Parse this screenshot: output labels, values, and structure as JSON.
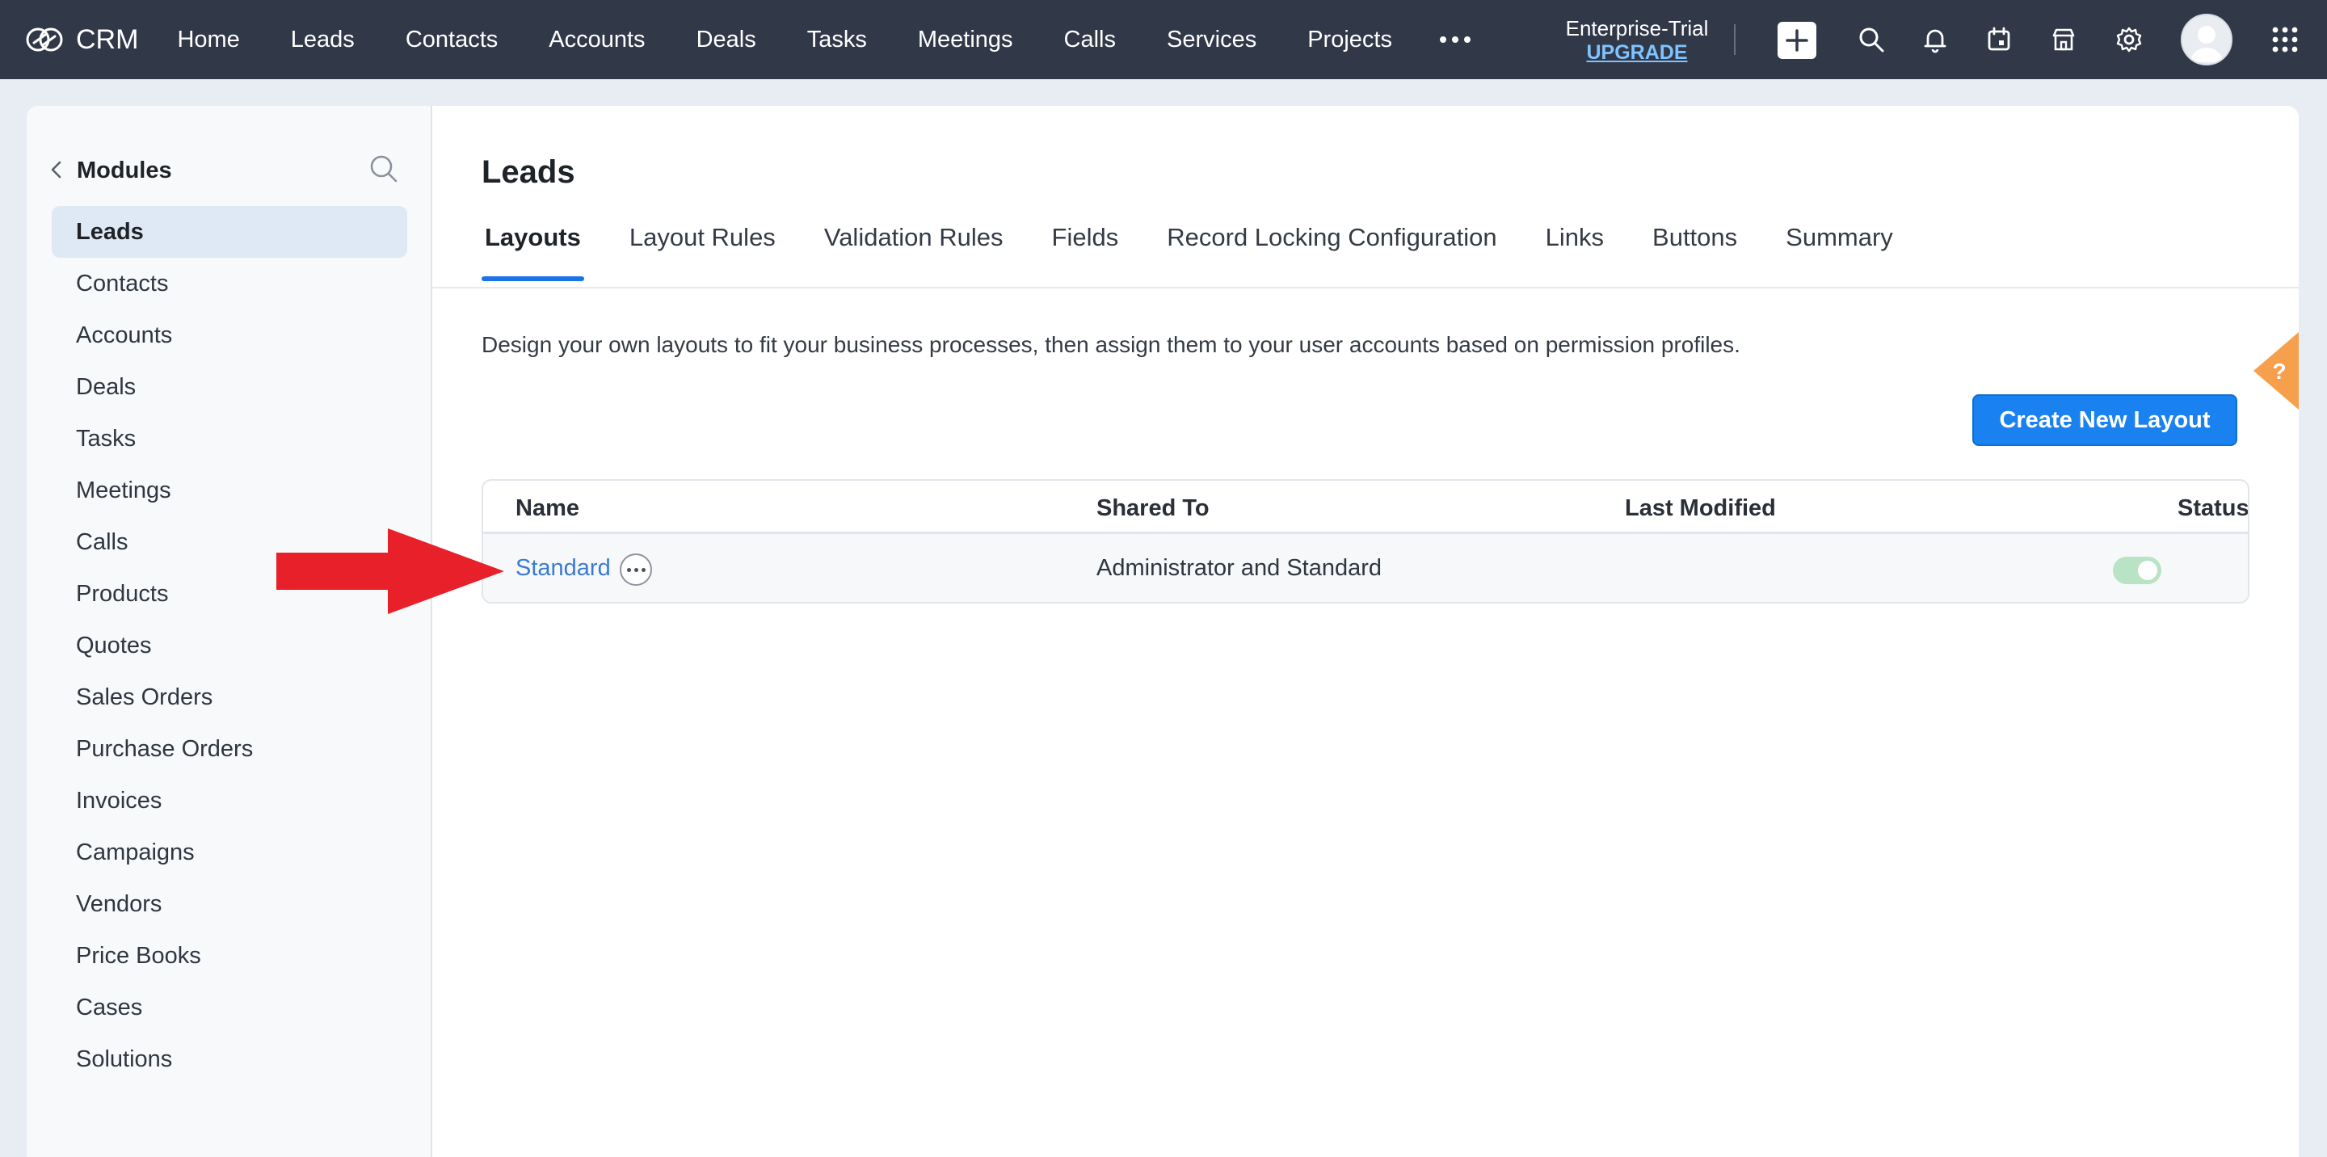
{
  "topbar": {
    "brand": "CRM",
    "nav": [
      "Home",
      "Leads",
      "Contacts",
      "Accounts",
      "Deals",
      "Tasks",
      "Meetings",
      "Calls",
      "Services",
      "Projects"
    ],
    "trial_name": "Enterprise-Trial",
    "upgrade_label": "UPGRADE"
  },
  "sidebar": {
    "title": "Modules",
    "items": [
      "Leads",
      "Contacts",
      "Accounts",
      "Deals",
      "Tasks",
      "Meetings",
      "Calls",
      "Products",
      "Quotes",
      "Sales Orders",
      "Purchase Orders",
      "Invoices",
      "Campaigns",
      "Vendors",
      "Price Books",
      "Cases",
      "Solutions"
    ],
    "active": "Leads"
  },
  "main": {
    "title": "Leads",
    "tabs": [
      "Layouts",
      "Layout Rules",
      "Validation Rules",
      "Fields",
      "Record Locking Configuration",
      "Links",
      "Buttons",
      "Summary"
    ],
    "active_tab": "Layouts",
    "description": "Design your own layouts to fit your business processes, then assign them to your user accounts based on permission profiles.",
    "create_button": "Create New Layout",
    "help_label": "?"
  },
  "table": {
    "columns": [
      "Name",
      "Shared To",
      "Last Modified",
      "Status"
    ],
    "rows": [
      {
        "name": "Standard",
        "shared_to": "Administrator and Standard",
        "last_modified": "",
        "status_enabled": true
      }
    ]
  },
  "colors": {
    "topbar": "#313949",
    "accent": "#1a82f0",
    "link": "#3a7bd5",
    "annotation_arrow": "#e8202a",
    "toggle_on": "#b8e3c4"
  }
}
